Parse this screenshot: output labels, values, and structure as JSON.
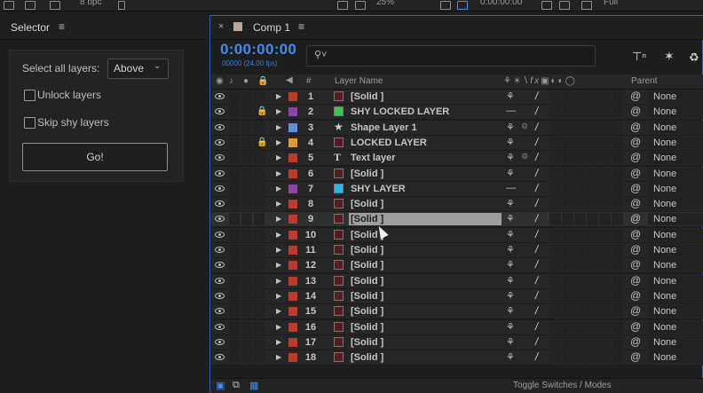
{
  "topbar": {
    "bpc": "8 bpc",
    "zoom": "25%",
    "time": "0:00:00:00",
    "resolution": "Full"
  },
  "selector": {
    "title": "Selector",
    "menu_icon": "hamburger-icon",
    "select_all_label": "Select all layers:",
    "select_all_value": "Above",
    "unlock_label": "Unlock layers",
    "skip_shy_label": "Skip shy layers",
    "go_label": "Go!"
  },
  "comp": {
    "tab_label": "Comp 1",
    "timecode": "0:00:00:00",
    "fps": "00000 (24.00 fps)",
    "search_placeholder": ""
  },
  "columns": {
    "num": "#",
    "layer_name": "Layer Name",
    "parent": "Parent"
  },
  "layers": [
    {
      "num": "1",
      "name": "[Solid ]",
      "color": "#c0392b",
      "src": "#5a1a22",
      "locked": false,
      "shy": false
    },
    {
      "num": "2",
      "name": "SHY LOCKED LAYER",
      "color": "#8e44ad",
      "src": "#2ecc40",
      "locked": true,
      "shy": true
    },
    {
      "num": "3",
      "name": "Shape Layer 1",
      "color": "#5b8fe0",
      "src": "star",
      "locked": false,
      "shy": false
    },
    {
      "num": "4",
      "name": "LOCKED LAYER",
      "color": "#e8962e",
      "src": "#5a1a22",
      "locked": true,
      "shy": false
    },
    {
      "num": "5",
      "name": "Text layer",
      "color": "#c0392b",
      "src": "T",
      "locked": false,
      "shy": false
    },
    {
      "num": "6",
      "name": "[Solid ]",
      "color": "#c0392b",
      "src": "#5a1a22",
      "locked": false,
      "shy": false
    },
    {
      "num": "7",
      "name": "SHY LAYER",
      "color": "#8e44ad",
      "src": "#1fb8f0",
      "locked": false,
      "shy": true
    },
    {
      "num": "8",
      "name": "[Solid ]",
      "color": "#c0392b",
      "src": "#5a1a22",
      "locked": false,
      "shy": false
    },
    {
      "num": "9",
      "name": "[Solid ]",
      "color": "#c0392b",
      "src": "#5a1a22",
      "locked": false,
      "shy": false
    },
    {
      "num": "10",
      "name": "[Solid ]",
      "color": "#c0392b",
      "src": "#5a1a22",
      "locked": false,
      "shy": false
    },
    {
      "num": "11",
      "name": "[Solid ]",
      "color": "#c0392b",
      "src": "#5a1a22",
      "locked": false,
      "shy": false
    },
    {
      "num": "12",
      "name": "[Solid ]",
      "color": "#c0392b",
      "src": "#5a1a22",
      "locked": false,
      "shy": false
    },
    {
      "num": "13",
      "name": "[Solid ]",
      "color": "#c0392b",
      "src": "#5a1a22",
      "locked": false,
      "shy": false
    },
    {
      "num": "14",
      "name": "[Solid ]",
      "color": "#c0392b",
      "src": "#5a1a22",
      "locked": false,
      "shy": false
    },
    {
      "num": "15",
      "name": "[Solid ]",
      "color": "#c0392b",
      "src": "#5a1a22",
      "locked": false,
      "shy": false
    },
    {
      "num": "16",
      "name": "[Solid ]",
      "color": "#c0392b",
      "src": "#5a1a22",
      "locked": false,
      "shy": false
    },
    {
      "num": "17",
      "name": "[Solid ]",
      "color": "#c0392b",
      "src": "#5a1a22",
      "locked": false,
      "shy": false
    },
    {
      "num": "18",
      "name": "[Solid ]",
      "color": "#c0392b",
      "src": "#5a1a22",
      "locked": false,
      "shy": false
    }
  ],
  "selected_layer": "9",
  "parent_value": "None",
  "bottom": {
    "toggle_label": "Toggle Switches / Modes"
  }
}
